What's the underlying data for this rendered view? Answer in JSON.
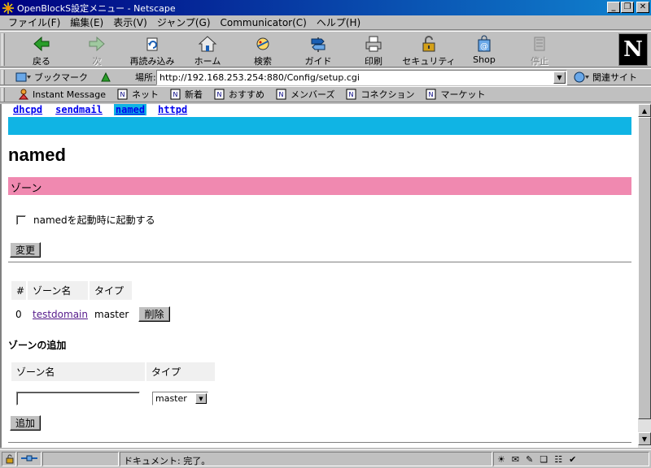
{
  "window": {
    "title": "OpenBlockS設定メニュー - Netscape"
  },
  "menu": [
    "ファイル(F)",
    "編集(E)",
    "表示(V)",
    "ジャンプ(G)",
    "Communicator(C)",
    "ヘルプ(H)"
  ],
  "nav": {
    "back": "戻る",
    "forward": "次",
    "reload": "再読み込み",
    "home": "ホーム",
    "search": "検索",
    "guide": "ガイド",
    "print": "印刷",
    "security": "セキュリティ",
    "shop": "Shop",
    "stop": "停止"
  },
  "location": {
    "bookmarks": "ブックマーク",
    "label": "場所:",
    "url": "http://192.168.253.254:880/Config/setup.cgi",
    "related": "関連サイト"
  },
  "personal": [
    "Instant Message",
    "ネット",
    "新着",
    "おすすめ",
    "メンバーズ",
    "コネクション",
    "マーケット"
  ],
  "page": {
    "tabs": [
      {
        "label": "dhcpd",
        "active": false
      },
      {
        "label": "sendmail",
        "active": false
      },
      {
        "label": "named",
        "active": true
      },
      {
        "label": "httpd",
        "active": false
      }
    ],
    "title": "named",
    "section": "ゾーン",
    "checkbox_label": "namedを起動時に起動する",
    "change_button": "変更",
    "zone_table": {
      "headers": [
        "#",
        "ゾーン名",
        "タイプ"
      ],
      "rows": [
        {
          "index": "0",
          "name": "testdomain",
          "type": "master",
          "delete": "削除"
        }
      ]
    },
    "add_title": "ゾーンの追加",
    "add_table": {
      "headers": [
        "ゾーン名",
        "タイプ"
      ],
      "zone_value": "",
      "type_selected": "master"
    },
    "add_button": "追加"
  },
  "status": {
    "text": "ドキュメント: 完了。"
  },
  "colors": {
    "tab_bar": "#10b4e4",
    "section_bar": "#f089b0",
    "title_bar": "#000080"
  }
}
